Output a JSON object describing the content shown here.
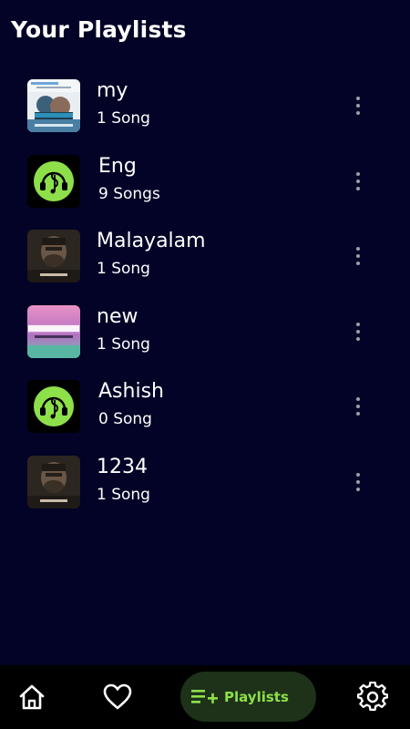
{
  "header": {
    "title": "Your Playlists"
  },
  "playlists": [
    {
      "name": "my",
      "count": "1 Song",
      "thumb": "album-art-movie-poster"
    },
    {
      "name": "Eng",
      "count": "9 Songs",
      "thumb": "music-note-headphones-icon"
    },
    {
      "name": "Malayalam",
      "count": "1 Song",
      "thumb": "album-art-sunny"
    },
    {
      "name": "new",
      "count": "1 Song",
      "thumb": "album-art-thousand-years"
    },
    {
      "name": "Ashish",
      "count": "0 Song",
      "thumb": "music-note-headphones-icon"
    },
    {
      "name": "1234",
      "count": "1 Song",
      "thumb": "album-art-sunny"
    }
  ],
  "nav": {
    "home_icon": "home-icon",
    "favorites_icon": "heart-icon",
    "playlists_label": "Playlists",
    "playlists_icon": "playlist-add-icon",
    "settings_icon": "gear-icon"
  },
  "colors": {
    "background": "#020326",
    "accent": "#8ee04a",
    "nav_background": "#000000",
    "active_pill": "#1d3219"
  }
}
